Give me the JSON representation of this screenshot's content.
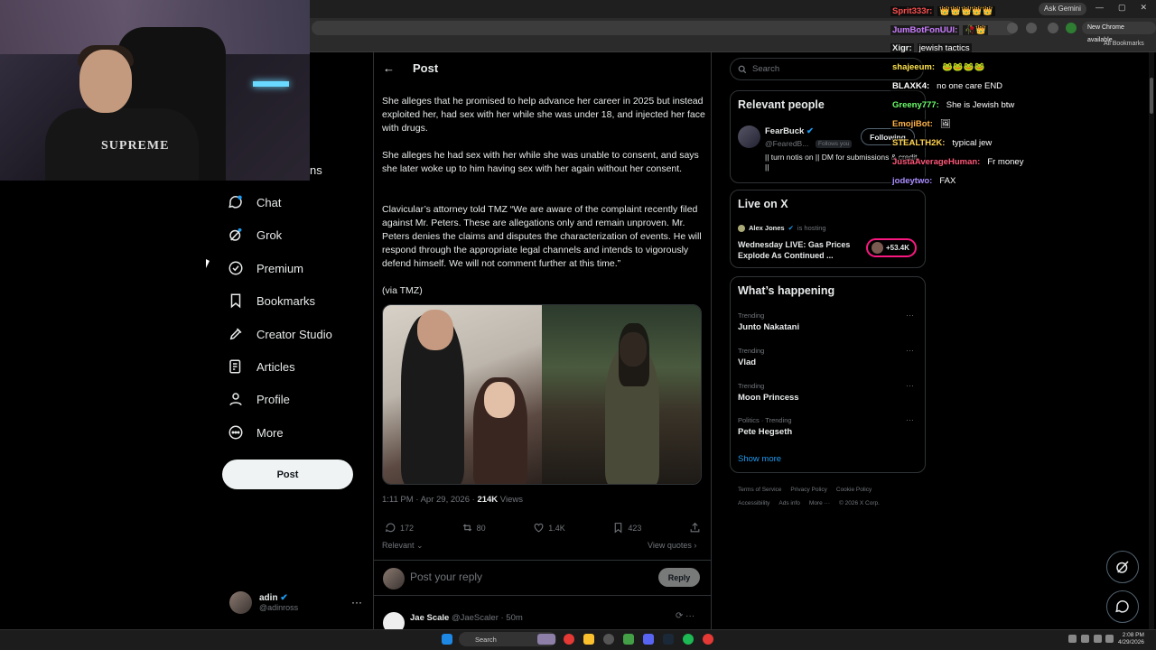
{
  "browser": {
    "ask_gemini": "Ask Gemini",
    "new_chrome": "New Chrome available",
    "all_bookmarks": "All Bookmarks"
  },
  "webcam": {
    "shirt_logo": "SUPREME"
  },
  "sidebar": {
    "partial_item": "ns",
    "items": [
      {
        "label": "Chat"
      },
      {
        "label": "Grok"
      },
      {
        "label": "Premium"
      },
      {
        "label": "Bookmarks"
      },
      {
        "label": "Creator Studio"
      },
      {
        "label": "Articles"
      },
      {
        "label": "Profile"
      },
      {
        "label": "More"
      }
    ],
    "post_button": "Post",
    "account": {
      "name": "adin",
      "handle": "@adinross",
      "more": "···"
    }
  },
  "main": {
    "header_title": "Post",
    "back": "←",
    "paragraphs": [
      "She alleges that he promised to help advance her career in 2025 but instead exploited her, had sex with her while she was under 18, and injected her face with drugs.",
      "She alleges he had sex with her while she was unable to consent, and says she later woke up to him having sex with her again without her consent.",
      "Clavicular’s attorney told TMZ “We are aware of the complaint recently filed against Mr. Peters. These are allegations only and remain unproven. Mr. Peters denies the claims and disputes the characterization of events. He will respond through the appropriate legal channels and intends to vigorously defend himself. We will not comment further at this time.”",
      "(via TMZ)"
    ],
    "meta_time": "1:11 PM · Apr 29, 2026 · ",
    "meta_views_count": "214K",
    "meta_views_label": " Views",
    "actions": {
      "replies": "172",
      "reposts": "80",
      "likes": "1.4K",
      "bookmarks": "423"
    },
    "relevant": "Relevant",
    "view_quotes": "View quotes",
    "reply_placeholder": "Post your reply",
    "reply_button": "Reply",
    "next_reply": {
      "name": "Jae Scale",
      "handle": "@JaeScaler · 50m"
    }
  },
  "right": {
    "search_placeholder": "Search",
    "relevant_people": {
      "title": "Relevant people",
      "name": "FearBuck",
      "handle": "@FearedB...",
      "follows_you": "Follows you",
      "follow_state": "Following",
      "bio": "|| turn notis on || DM for submissions & credit ||"
    },
    "live": {
      "title": "Live on X",
      "host_name": "Alex Jones",
      "host_suffix": "is hosting",
      "stream_title": "Wednesday LIVE: Gas Prices Explode As Continued ...",
      "listeners": "+53.4K"
    },
    "happening": {
      "title": "What’s happening",
      "trends": [
        {
          "category": "Trending",
          "topic": "Junto Nakatani"
        },
        {
          "category": "Trending",
          "topic": "Vlad"
        },
        {
          "category": "Trending",
          "topic": "Moon Princess"
        },
        {
          "category": "Politics · Trending",
          "topic": "Pete Hegseth"
        }
      ],
      "show_more": "Show more"
    },
    "footer": [
      "Terms of Service",
      "Privacy Policy",
      "Cookie Policy",
      "Accessibility",
      "Ads info",
      "More ···",
      "© 2026 X Corp."
    ]
  },
  "stream_chat": [
    {
      "user": "Sprit333r:",
      "msg": "👑👑👑👑👑",
      "color": "#ff4d4d"
    },
    {
      "user": "JumBotFonUUI:",
      "msg": "🥀👑",
      "color": "#c97bff"
    },
    {
      "user": "Xigr:",
      "msg": "jewish tactics",
      "color": "#e7e9ea"
    },
    {
      "user": "shajeeum:",
      "msg": "🐸🐸🐸🐸",
      "color": "#ffe44d"
    },
    {
      "user": "BLAXK4:",
      "msg": "no one care END",
      "color": "#ffffff"
    },
    {
      "user": "Greeny777:",
      "msg": "She is Jewish btw",
      "color": "#6bff6b"
    },
    {
      "user": "EmojiBot:",
      "msg": "🖼",
      "color": "#ffb347"
    },
    {
      "user": "STEALTH2K:",
      "msg": "typical jew",
      "color": "#ffd24d"
    },
    {
      "user": "JustaAverageHuman:",
      "msg": "Fr money",
      "color": "#ff5577"
    },
    {
      "user": "jodeytwo:",
      "msg": "FAX",
      "color": "#a98bff"
    }
  ],
  "taskbar": {
    "search": "Search",
    "time": "2:08 PM",
    "date": "4/29/2026"
  },
  "colors": {
    "accent": "#1d9bf0",
    "live_border": "#f91880",
    "background": "#000000"
  }
}
